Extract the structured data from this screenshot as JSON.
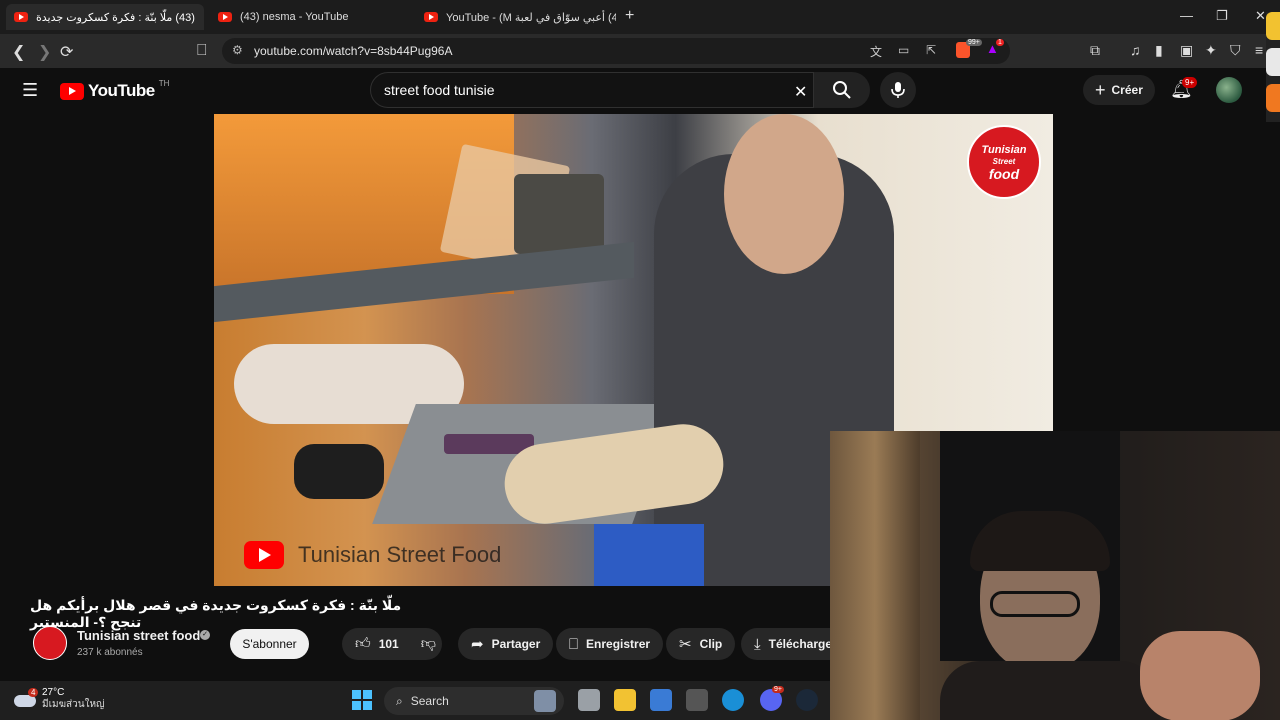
{
  "browser": {
    "tabs": [
      {
        "title": "(43) ملّا بنّة : فكرة كسكروت جديدة",
        "active": true
      },
      {
        "title": "(43) nesma - YouTube",
        "active": false
      },
      {
        "title": "(43) أعبي سوّاق في لعبة YouTube - (M",
        "active": false
      }
    ],
    "new_tab": "+",
    "url": "youtube.com/watch?v=8sb44Pug96A",
    "brave_badge": "99+",
    "rewards_badge": "1"
  },
  "youtube": {
    "logo_text": "YouTube",
    "logo_region": "TH",
    "search_query": "street food tunisie",
    "create_label": "Créer",
    "notif_badge": "9+"
  },
  "video": {
    "brand_logo_lines": [
      "Tunisian",
      "Street",
      "food"
    ],
    "watermark_text": "Tunisian Street Food",
    "title": "ملّا بنّة : فكرة كسكروت جديدة في قصر هلال برأيكم هل تنجح ؟- المنستير",
    "channel_name": "Tunisian street food",
    "subscribers": "237 k abonnés",
    "subscribe_label": "S'abonner",
    "likes": "101",
    "share_label": "Partager",
    "save_label": "Enregistrer",
    "clip_label": "Clip",
    "download_label": "Télécharge"
  },
  "taskbar": {
    "weather_badge": "4",
    "temperature": "27°C",
    "weather_desc": "มีเมฆส่วนใหญ่",
    "search_label": "Search",
    "discord_badge": "9+"
  },
  "colors": {
    "yt_red": "#ff0000",
    "brand_red": "#d71920",
    "bg": "#0f0f0f"
  }
}
